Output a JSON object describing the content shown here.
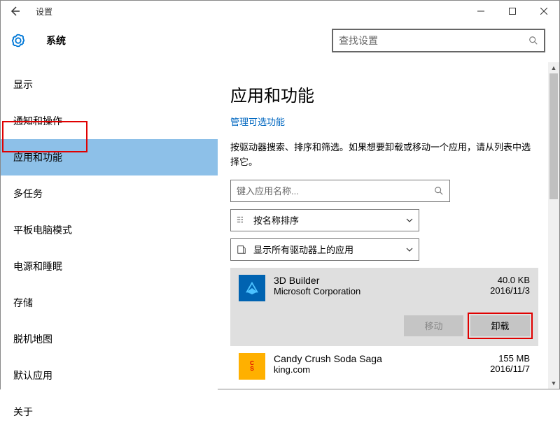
{
  "window": {
    "title": "设置"
  },
  "header": {
    "title": "系统"
  },
  "search": {
    "placeholder": "查找设置"
  },
  "sidebar": {
    "items": [
      {
        "label": "显示"
      },
      {
        "label": "通知和操作"
      },
      {
        "label": "应用和功能",
        "selected": true
      },
      {
        "label": "多任务"
      },
      {
        "label": "平板电脑模式"
      },
      {
        "label": "电源和睡眠"
      },
      {
        "label": "存储"
      },
      {
        "label": "脱机地图"
      },
      {
        "label": "默认应用"
      },
      {
        "label": "关于"
      }
    ]
  },
  "page": {
    "heading": "应用和功能",
    "manage_link": "管理可选功能",
    "description": "按驱动器搜索、排序和筛选。如果想要卸载或移动一个应用，请从列表中选择它。",
    "search_placeholder": "键入应用名称...",
    "sort_label": "按名称排序",
    "filter_label": "显示所有驱动器上的应用"
  },
  "apps": [
    {
      "name": "3D Builder",
      "publisher": "Microsoft Corporation",
      "size": "40.0 KB",
      "date": "2016/11/3",
      "selected": true,
      "move_label": "移动",
      "uninstall_label": "卸载"
    },
    {
      "name": "Candy Crush Soda Saga",
      "publisher": "king.com",
      "size": "155 MB",
      "date": "2016/11/7"
    }
  ]
}
